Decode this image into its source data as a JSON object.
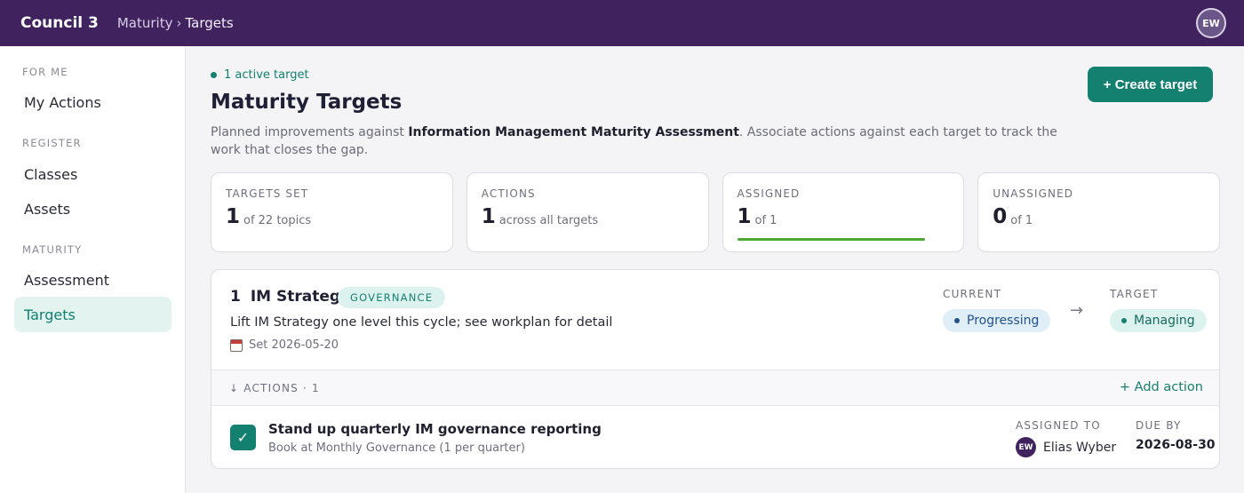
{
  "header": {
    "brand": "Council 3",
    "breadcrumb": [
      "Maturity",
      "Targets"
    ],
    "breadcrumb_sep": "›",
    "user_initials": "EW"
  },
  "sidebar": {
    "sections": [
      {
        "title": "FOR ME",
        "items": [
          "My Actions"
        ]
      },
      {
        "title": "REGISTER",
        "items": [
          "Classes",
          "Assets"
        ]
      },
      {
        "title": "MATURITY",
        "items": [
          "Assessment",
          "Targets"
        ]
      }
    ],
    "active_item": "Targets"
  },
  "page": {
    "active_count": "1 active target",
    "title": "Maturity Targets",
    "desc_prefix": "Planned improvements against ",
    "desc_bold": "Information Management Maturity Assessment",
    "desc_suffix": ". Associate actions against each target to track the work that closes the gap.",
    "create_button": "+ Create target"
  },
  "stats": [
    {
      "label": "TARGETS SET",
      "value": "1",
      "sub": "of 22 topics"
    },
    {
      "label": "ACTIONS",
      "value": "1",
      "sub": "across all targets"
    },
    {
      "label": "ASSIGNED",
      "value": "1",
      "sub": "of 1",
      "progress": 1.0
    },
    {
      "label": "UNASSIGNED",
      "value": "0",
      "sub": "of 1"
    }
  ],
  "target": {
    "index": "1",
    "name": "IM Strategy",
    "category": "GOVERNANCE",
    "description": "Lift IM Strategy one level this cycle; see workplan for detail",
    "set_date": "Set 2026-05-20",
    "current_label": "CURRENT",
    "current_level": "Progressing",
    "arrow": "→",
    "target_label": "TARGET",
    "target_level": "Managing",
    "actions_header": "↓ ACTIONS · 1",
    "add_action": "+ Add action",
    "action": {
      "title": "Stand up quarterly IM governance reporting",
      "subtitle": "Book at Monthly Governance (1 per quarter)",
      "checkmark": "✓",
      "assigned_to_label": "ASSIGNED TO",
      "assignee_initials": "EW",
      "assignee": "Elias Wyber",
      "due_label": "DUE BY",
      "due_date": "2026-08-30"
    }
  },
  "colors": {
    "topbar": "#40235e",
    "accent": "#138070",
    "progress": "#4aa833"
  }
}
